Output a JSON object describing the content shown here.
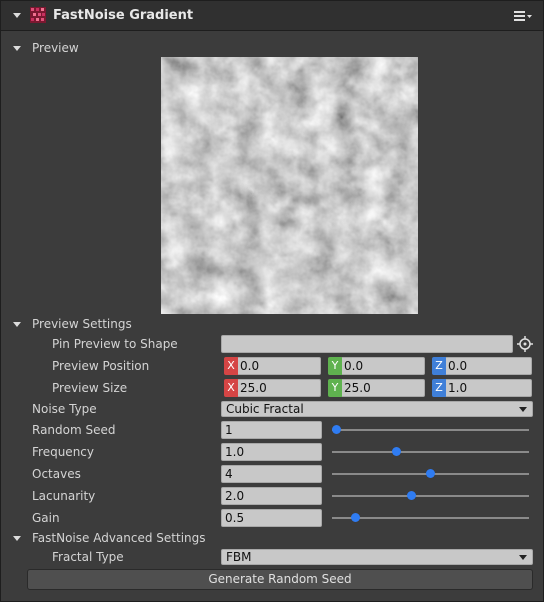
{
  "header": {
    "title": "FastNoise Gradient",
    "logo_icon": "fastnoise-logo-icon",
    "menu_icon": "hamburger-menu-icon"
  },
  "preview_section": {
    "label": "Preview"
  },
  "preview_settings": {
    "label": "Preview Settings",
    "pin_label": "Pin Preview to Shape",
    "pin_value": "",
    "position_label": "Preview Position",
    "position": {
      "x_axis": "X",
      "x": "0.0",
      "y_axis": "Y",
      "y": "0.0",
      "z_axis": "Z",
      "z": "0.0"
    },
    "size_label": "Preview Size",
    "size": {
      "x_axis": "X",
      "x": "25.0",
      "y_axis": "Y",
      "y": "25.0",
      "z_axis": "Z",
      "z": "1.0"
    }
  },
  "params": {
    "noise_type_label": "Noise Type",
    "noise_type_value": "Cubic Fractal",
    "random_seed_label": "Random Seed",
    "random_seed_value": "1",
    "random_seed_slider": 0.0,
    "frequency_label": "Frequency",
    "frequency_value": "1.0",
    "frequency_slider": 0.32,
    "octaves_label": "Octaves",
    "octaves_value": "4",
    "octaves_slider": 0.5,
    "lacunarity_label": "Lacunarity",
    "lacunarity_value": "2.0",
    "lacunarity_slider": 0.4,
    "gain_label": "Gain",
    "gain_value": "0.5",
    "gain_slider": 0.1
  },
  "advanced": {
    "label": "FastNoise Advanced Settings",
    "fractal_type_label": "Fractal Type",
    "fractal_type_value": "FBM"
  },
  "generate_button": "Generate Random Seed",
  "colors": {
    "accent": "#2f7cf2",
    "x_axis": "#d54545",
    "y_axis": "#5fb24f",
    "z_axis": "#3f7fd8"
  }
}
